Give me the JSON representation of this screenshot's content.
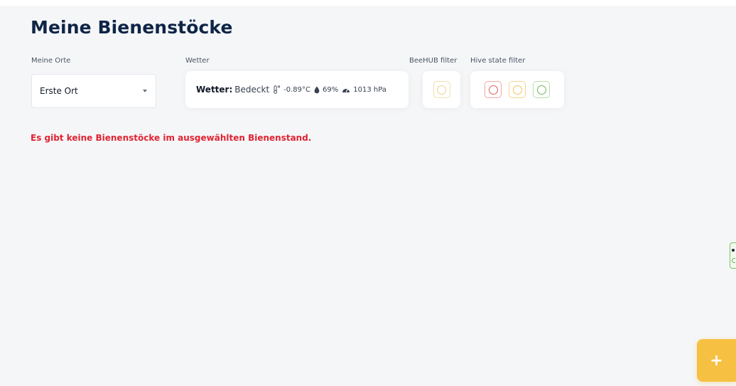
{
  "page": {
    "title": "Meine Bienenstöcke"
  },
  "location": {
    "label": "Meine Orte",
    "selected": "Erste Ort"
  },
  "weather": {
    "section_label": "Wetter",
    "label": "Wetter:",
    "condition": "Bedeckt",
    "temperature": "-0.89°C",
    "humidity": "69%",
    "pressure": "1013 hPa",
    "icons": [
      "thermometer-icon",
      "droplet-icon",
      "gauge-icon"
    ]
  },
  "beehub_filter": {
    "label": "BeeHUB filter",
    "color": "#efd08a"
  },
  "hive_state_filter": {
    "label": "Hive state filter",
    "colors": {
      "red": "#e05a5a",
      "yellow": "#f0c45c",
      "green": "#6cb55a"
    }
  },
  "message": {
    "text": "Es gibt keine Bienenstöcke im ausgewählten Bienenstand.",
    "color": "#e02432"
  },
  "fab": {
    "symbol": "+",
    "color": "#f6c142"
  },
  "theme": {
    "title_color": "#0f2547",
    "background": "#f5f6f8"
  }
}
